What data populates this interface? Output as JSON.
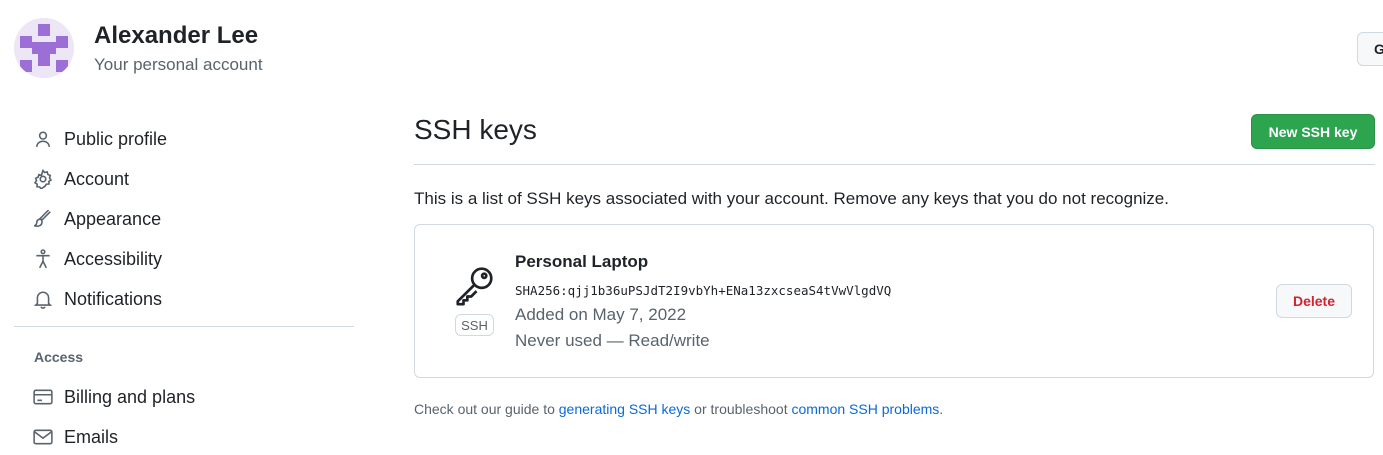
{
  "header": {
    "user_name": "Alexander Lee",
    "user_subtitle": "Your personal account",
    "goto_button_label": "G"
  },
  "sidebar": {
    "items": [
      {
        "label": "Public profile",
        "icon": "person-icon"
      },
      {
        "label": "Account",
        "icon": "gear-icon"
      },
      {
        "label": "Appearance",
        "icon": "paintbrush-icon"
      },
      {
        "label": "Accessibility",
        "icon": "accessibility-icon"
      },
      {
        "label": "Notifications",
        "icon": "bell-icon"
      }
    ],
    "access_heading": "Access",
    "access_items": [
      {
        "label": "Billing and plans",
        "icon": "credit-card-icon"
      },
      {
        "label": "Emails",
        "icon": "mail-icon"
      }
    ]
  },
  "main": {
    "title": "SSH keys",
    "new_key_button": "New SSH key",
    "intro": "This is a list of SSH keys associated with your account. Remove any keys that you do not recognize.",
    "keys": [
      {
        "name": "Personal Laptop",
        "fingerprint": "SHA256:qjj1b36uPSJdT2I9vbYh+ENa13zxcseaS4tVwVlgdVQ",
        "added": "Added on May 7, 2022",
        "usage": "Never used — Read/write",
        "badge": "SSH",
        "delete_label": "Delete"
      }
    ],
    "footer": {
      "prefix": "Check out our guide to ",
      "link1": "generating SSH keys",
      "middle": " or troubleshoot ",
      "link2": "common SSH problems",
      "suffix": "."
    }
  },
  "colors": {
    "primary_button": "#2da44e",
    "danger_text": "#d1242f",
    "link": "#0969da",
    "avatar_accent": "#9b6fd6"
  }
}
